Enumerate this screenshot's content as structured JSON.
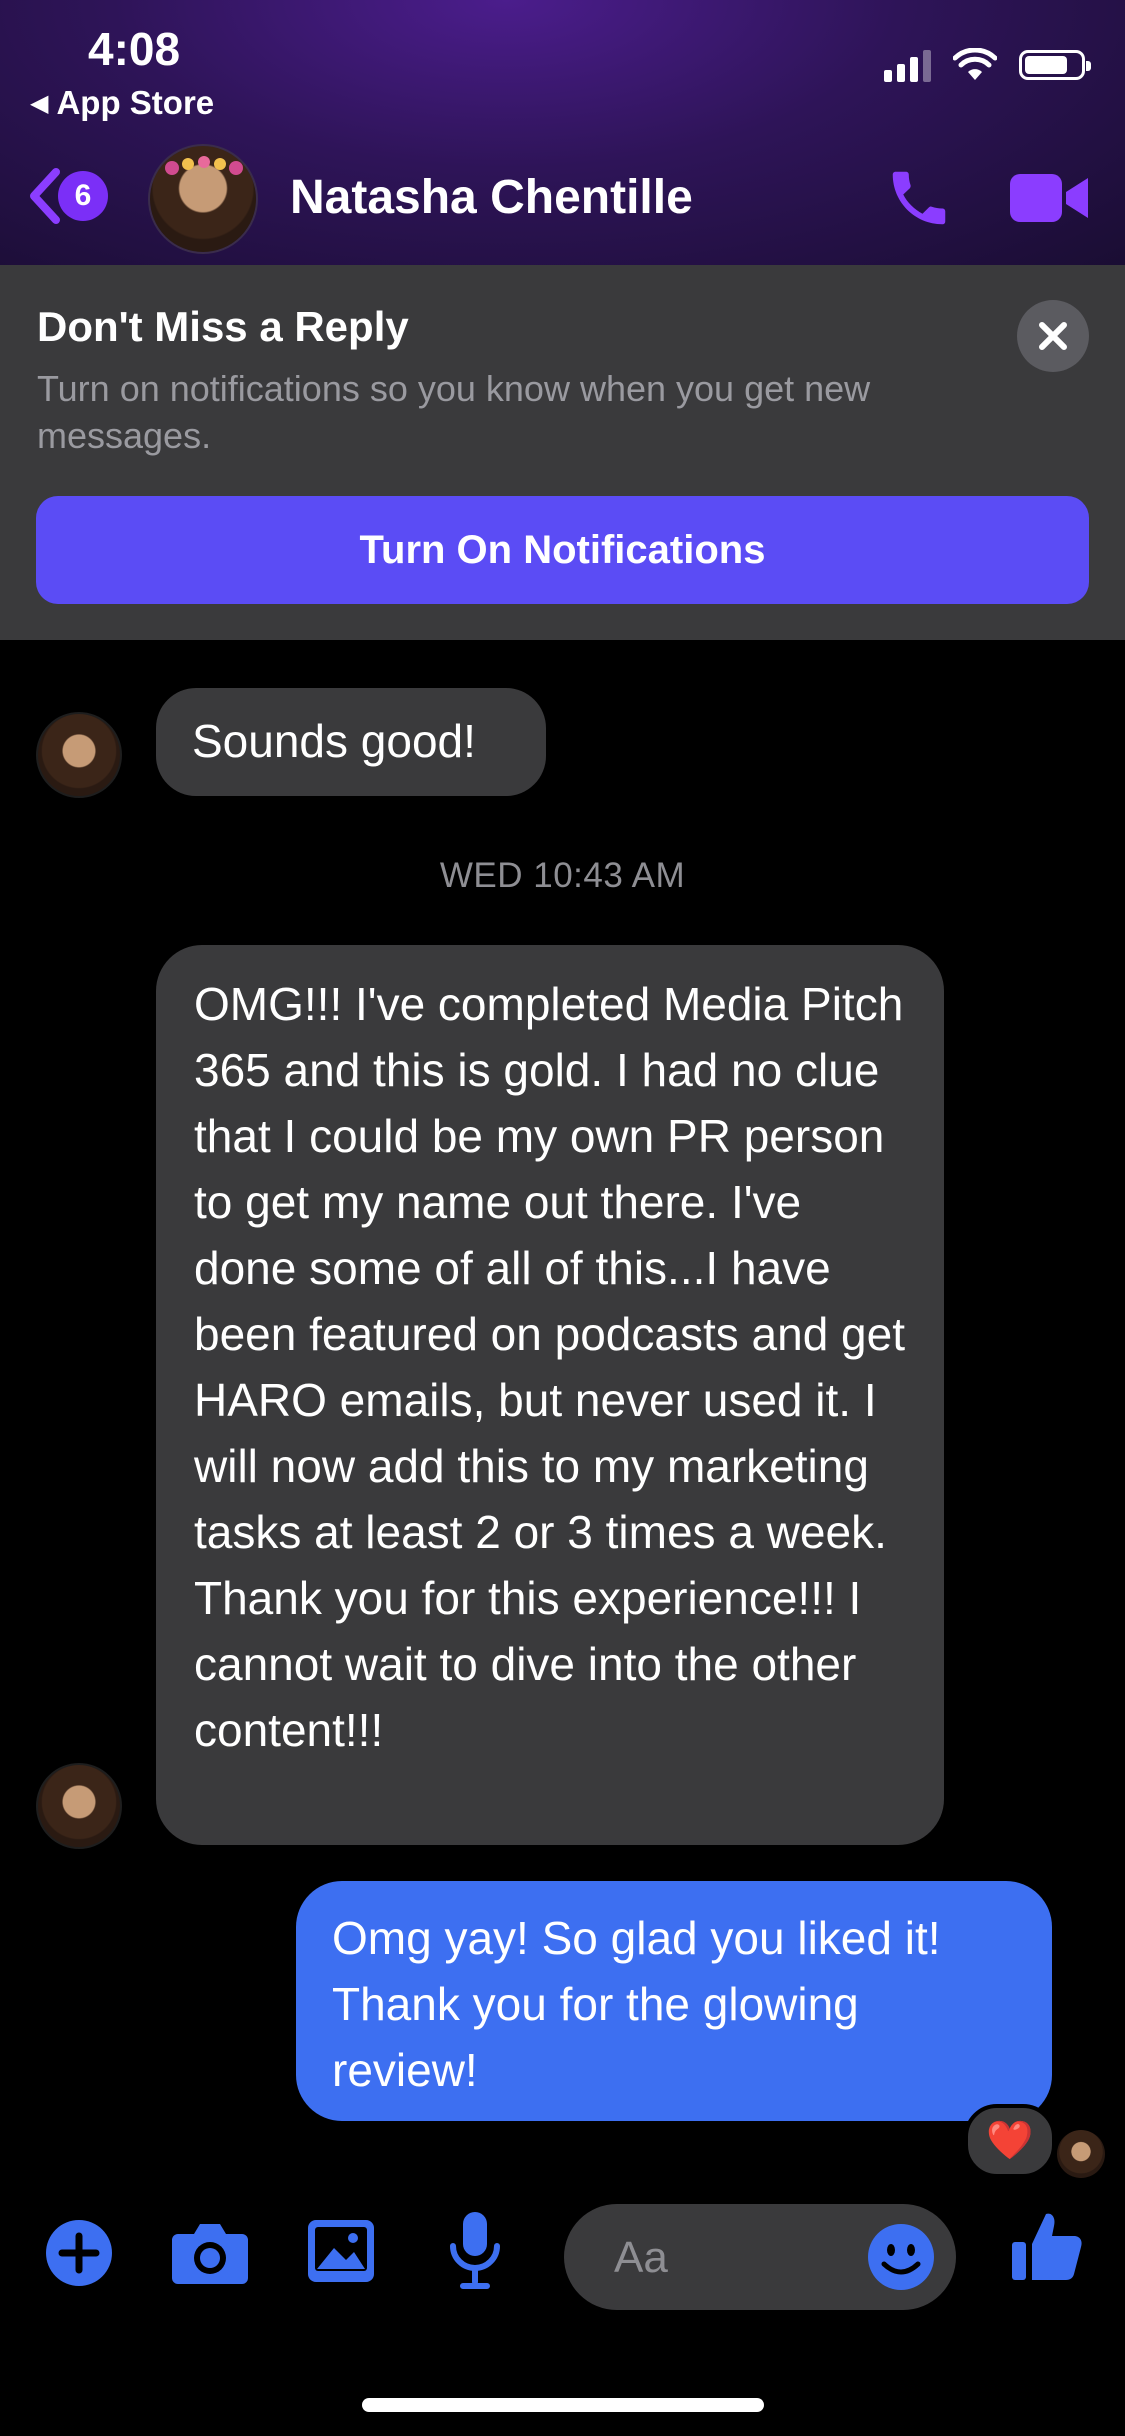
{
  "status_bar": {
    "time": "4:08",
    "back_app": "App Store"
  },
  "header": {
    "unread_count": "6",
    "contact_name": "Natasha Chentille"
  },
  "banner": {
    "title": "Don't Miss a Reply",
    "text": "Turn on notifications so you know when you get new messages.",
    "button_label": "Turn On Notifications"
  },
  "messages": [
    {
      "from": "contact",
      "text": "Sounds good!"
    },
    {
      "timestamp": "WED 10:43 AM"
    },
    {
      "from": "contact",
      "text": "OMG!!! I've completed Media Pitch 365 and this is gold. I had no clue that I could be my own PR person to get my name out there. I've done some of all of this...I have been featured on podcasts and get HARO emails, but never used it. I will now add this to my marketing tasks at least 2 or 3 times a week. Thank you for this experience!!! I cannot wait to dive into the other content!!!"
    },
    {
      "from": "me",
      "text": "Omg yay! So glad you liked it! Thank you for the glowing review!",
      "reaction": "❤️"
    }
  ],
  "composer": {
    "placeholder": "Aa"
  },
  "colors": {
    "accent_purple": "#8b3dff",
    "accent_blue": "#3d6ff1",
    "bubble_gray": "#3a3a3c",
    "banner_button": "#5b4cf5"
  },
  "icons": [
    "back-chevron-icon",
    "phone-icon",
    "video-camera-icon",
    "close-icon",
    "plus-icon",
    "camera-icon",
    "photo-icon",
    "microphone-icon",
    "smiley-icon",
    "thumbs-up-icon",
    "heart-icon"
  ]
}
